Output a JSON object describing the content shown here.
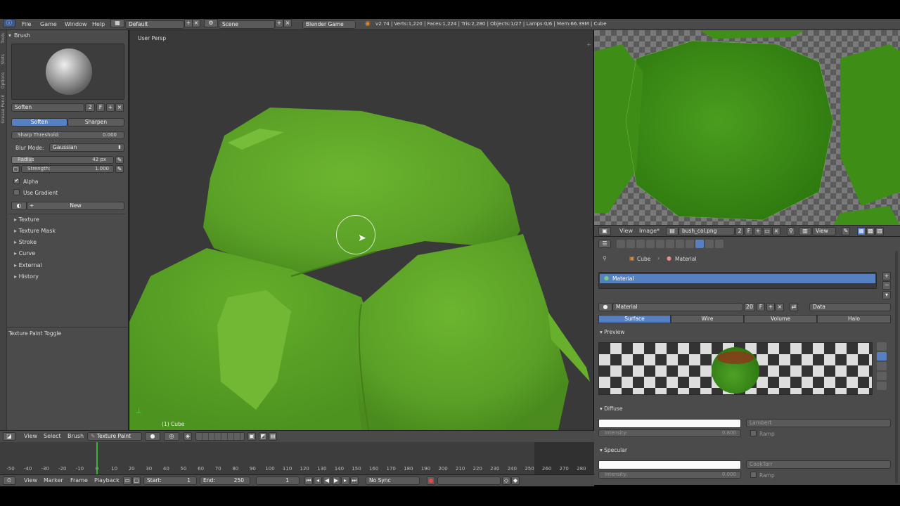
{
  "topbar": {
    "menus": [
      "File",
      "Game",
      "Window",
      "Help"
    ],
    "screen_layout": "Default",
    "scene": "Scene",
    "engine": "Blender Game",
    "stats": "v2.74 | Verts:1,220 | Faces:1,224 | Tris:2,280 | Objects:1/27 | Lamps:0/6 | Mem:66.39M | Cube"
  },
  "toolstrip": [
    "Tools",
    "Slots",
    "Options",
    "Grease Pencil"
  ],
  "tool_panel": {
    "brush_header": "Brush",
    "brush_name": "Soften",
    "brush_users": "2",
    "brush_fake": "F",
    "mode_buttons": [
      "Soften",
      "Sharpen"
    ],
    "sharp_threshold_label": "Sharp Threshold:",
    "sharp_threshold_value": "0.000",
    "blur_mode_label": "Blur Mode:",
    "blur_mode_value": "Gaussian",
    "radius_label": "Radius",
    "radius_value": "42 px",
    "strength_label": "Strength:",
    "strength_value": "1.000",
    "alpha_label": "Alpha",
    "use_gradient_label": "Use Gradient",
    "new_button": "New",
    "collapsed_panels": [
      "Texture",
      "Texture Mask",
      "Stroke",
      "Curve",
      "External",
      "History"
    ],
    "texture_paint_toggle": "Texture Paint Toggle"
  },
  "viewport": {
    "label": "User Persp",
    "object_label": "(1) Cube"
  },
  "image_editor": {
    "menus": [
      "View",
      "Image*"
    ],
    "image_name": "bush_col.png",
    "users": "2",
    "fake": "F",
    "view_menu": "View"
  },
  "properties": {
    "breadcrumb": [
      "Cube",
      "Material"
    ],
    "slot_name": "Material",
    "material_name": "Material",
    "material_users": "20",
    "material_fake": "F",
    "data_link": "Data",
    "tabs": [
      "Surface",
      "Wire",
      "Volume",
      "Halo"
    ],
    "preview_header": "Preview",
    "diffuse_header": "Diffuse",
    "diffuse_shader": "Lambert",
    "diffuse_intensity_label": "Intensity:",
    "diffuse_intensity_value": "0.800",
    "diffuse_ramp": "Ramp",
    "specular_header": "Specular",
    "specular_shader": "CookTorr",
    "specular_intensity_label": "Intensity:",
    "specular_intensity_value": "0.000",
    "specular_ramp": "Ramp"
  },
  "viewport_header": {
    "menus": [
      "View",
      "Select",
      "Brush"
    ],
    "mode": "Texture Paint"
  },
  "timeline": {
    "ticks": [
      "-50",
      "-40",
      "-30",
      "-20",
      "-10",
      "0",
      "10",
      "20",
      "30",
      "40",
      "50",
      "60",
      "70",
      "80",
      "90",
      "100",
      "110",
      "120",
      "130",
      "140",
      "150",
      "160",
      "170",
      "180",
      "190",
      "200",
      "210",
      "220",
      "230",
      "240",
      "250",
      "260",
      "270",
      "280"
    ],
    "current_frame_value": 0
  },
  "timeline_header": {
    "menus": [
      "View",
      "Marker",
      "Frame",
      "Playback"
    ],
    "start_label": "Start:",
    "start_value": "1",
    "end_label": "End:",
    "end_value": "250",
    "current_frame": "1",
    "sync": "No Sync"
  },
  "colors": {
    "accent_blue": "#5680c2",
    "bush_green": "#5faa2a",
    "panel_bg": "#4b4b4b",
    "viewport_bg": "#393939"
  }
}
